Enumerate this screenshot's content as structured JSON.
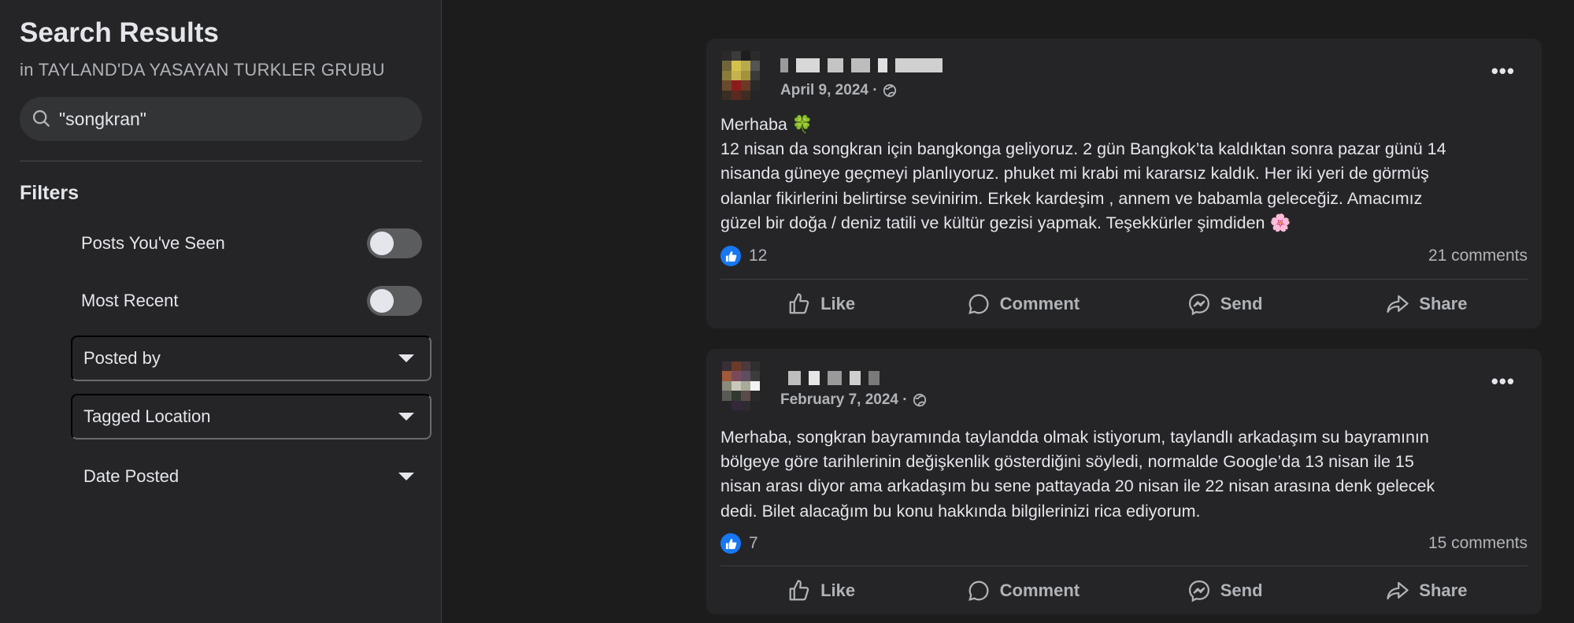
{
  "sidebar": {
    "title": "Search Results",
    "subtitle": "in TAYLAND'DA YASAYAN TURKLER GRUBU",
    "search_value": "\"songkran\"",
    "filters_title": "Filters",
    "filters": {
      "posts_seen": "Posts You've Seen",
      "most_recent": "Most Recent",
      "posted_by": "Posted by",
      "tagged_location": "Tagged Location",
      "date_posted": "Date Posted"
    }
  },
  "posts": [
    {
      "date": "April 9, 2024 ·",
      "text_lines": [
        "Merhaba 🍀",
        "12 nisan da songkran için bangkonga geliyoruz. 2 gün Bangkok’ta kaldıktan sonra pazar günü 14",
        "nisanda güneye geçmeyi planlıyoruz. phuket mi krabi mi kararsız kaldık. Her iki yeri de görmüş",
        "olanlar fikirlerini belirtirse sevinirim. Erkek kardeşim , annem ve babamla geleceğiz. Amacımız",
        "güzel bir doğa / deniz tatili ve kültür gezisi yapmak. Teşekkürler şimdiden 🌸"
      ],
      "likes": "12",
      "comments": "21 comments"
    },
    {
      "date": "February 7, 2024 ·",
      "text_lines": [
        "Merhaba, songkran bayramında taylandda olmak istiyorum, taylandlı arkadaşım su bayramının",
        "bölgeye göre tarihlerinin değişkenlik gösterdiğini söyledi, normalde Google’da 13 nisan ile 15",
        "nisan arası diyor ama arkadaşım bu sene pattayada 20 nisan ile 22 nisan arasına denk gelecek",
        "dedi. Bilet alacağım bu konu hakkında bilgilerinizi rica ediyorum."
      ],
      "likes": "7",
      "comments": "15 comments"
    }
  ],
  "actions": {
    "like": "Like",
    "comment": "Comment",
    "send": "Send",
    "share": "Share"
  },
  "icons": {
    "search": "search-icon",
    "globe": "globe-icon",
    "more": "more-options-icon",
    "like": "thumbs-up-icon",
    "comment": "comment-bubble-icon",
    "send": "messenger-icon",
    "share": "share-arrow-icon"
  },
  "colors": {
    "accent": "#1877f2",
    "background": "#1c1c1d",
    "panel": "#252527"
  }
}
